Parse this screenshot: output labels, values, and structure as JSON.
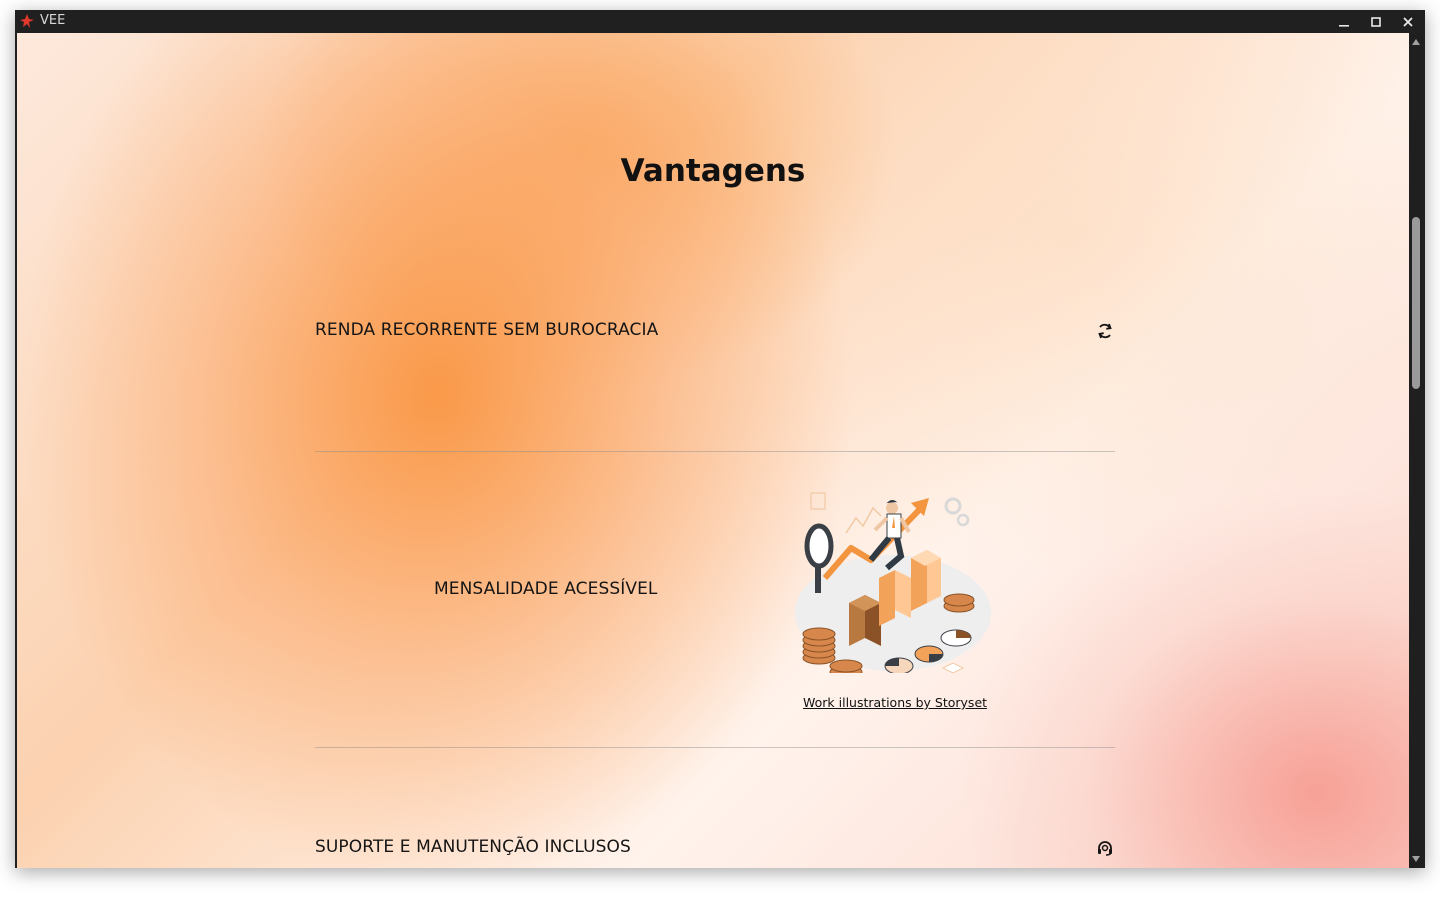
{
  "window": {
    "title": "VEE",
    "controls": [
      "minimize",
      "maximize",
      "close"
    ]
  },
  "page": {
    "title": "Vantagens",
    "rows": [
      {
        "label": "RENDA RECORRENTE SEM BUROCRACIA",
        "icon": "refresh-icon"
      },
      {
        "label": "MENSALIDADE ACESSÍVEL",
        "illustration": "finance-growth-illustration",
        "credit": "Work illustrations by Storyset"
      },
      {
        "label": "SUPORTE E MANUTENÇÃO INCLUSOS",
        "icon": "headset-support-icon"
      }
    ]
  },
  "colors": {
    "accent_orange": "#fa9440",
    "accent_pink": "#f6968c",
    "titlebar": "#202020",
    "text": "#151515"
  }
}
